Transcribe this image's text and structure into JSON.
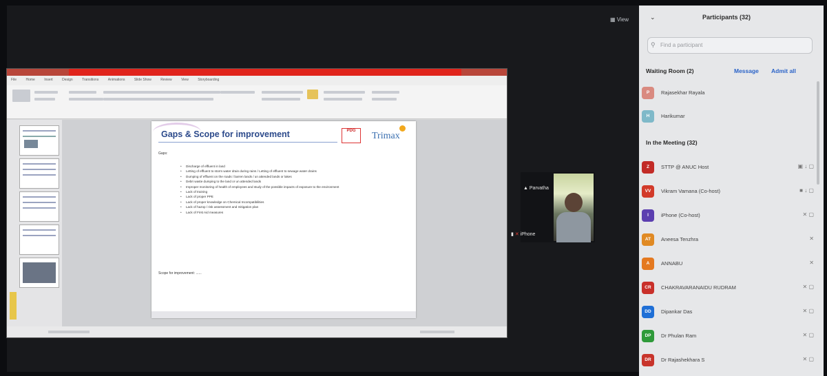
{
  "window": {
    "view_label": "View"
  },
  "ppt": {
    "tabs": [
      "File",
      "Home",
      "Insert",
      "Design",
      "Transitions",
      "Animations",
      "Slide Show",
      "Review",
      "View",
      "Storyboarding"
    ],
    "slide": {
      "title": "Gaps & Scope for improvement",
      "logo_left": "PDG",
      "logo_right": "Trimax",
      "gaps_heading": "Gaps:",
      "bullets": [
        "Discharge of effluent in land",
        "Letting of effluent to storm water drain during rains / Letting of effluent to sewage water drains",
        "Dumping of effluent on the roads / barren lands / un attended lands or lakes",
        "Debri waste dumping to the land or un attended lands",
        "Improper monitoring of health of employees and study of the possible impacts of exposure to the environment",
        "Lack of training",
        "Lack of proper PPE",
        "Lack of proper knowledge on Chemical Incompatibilities",
        "Lack of hazop / risk assessment and mitigation plan",
        "Lack of First Aid measures"
      ],
      "scope_heading": "Scope for improvement: ......"
    }
  },
  "video": {
    "name_top": "Parvatha",
    "name_bottom": "iPhone"
  },
  "participants": {
    "title": "Participants (32)",
    "search_placeholder": "Find a participant",
    "waiting_room": {
      "title": "Waiting Room (2)",
      "manage": "Message",
      "admit_all": "Admit all"
    },
    "waiting": [
      {
        "initials": "P",
        "name": "Rajasekhar Rayala",
        "color": "#d98a80"
      },
      {
        "initials": "H",
        "name": "Harikumar",
        "color": "#7fb9c9"
      }
    ],
    "in_meeting_title": "In the Meeting (32)",
    "members": [
      {
        "initials": "Z",
        "name": "STTP @ ANUC Host",
        "color": "#c22b27",
        "icons": "▣ ↓ ▢"
      },
      {
        "initials": "VV",
        "name": "Vikram Vamana (Co-host)",
        "color": "#d23a2a",
        "icons": "■ ↓ ▢"
      },
      {
        "initials": "I",
        "name": "iPhone (Co-host)",
        "color": "#5c3fb0",
        "icons": "✕ ▢"
      },
      {
        "initials": "AT",
        "name": "Aneesa Tenzhra",
        "color": "#e08a24",
        "icons": "✕"
      },
      {
        "initials": "A",
        "name": "ANNABU",
        "color": "#e47920",
        "icons": "✕"
      },
      {
        "initials": "CR",
        "name": "CHAKRAVARANAIDU RUDRAM",
        "color": "#c9302a",
        "icons": "✕ ▢"
      },
      {
        "initials": "DD",
        "name": "Dipankar Das",
        "color": "#1f6fd6",
        "icons": "✕ ▢"
      },
      {
        "initials": "DP",
        "name": "Dr Phulan Ram",
        "color": "#2f9a3a",
        "icons": "✕ ▢"
      },
      {
        "initials": "DR",
        "name": "Dr Rajashekhara S",
        "color": "#c8342b",
        "icons": "✕ ▢"
      }
    ]
  }
}
